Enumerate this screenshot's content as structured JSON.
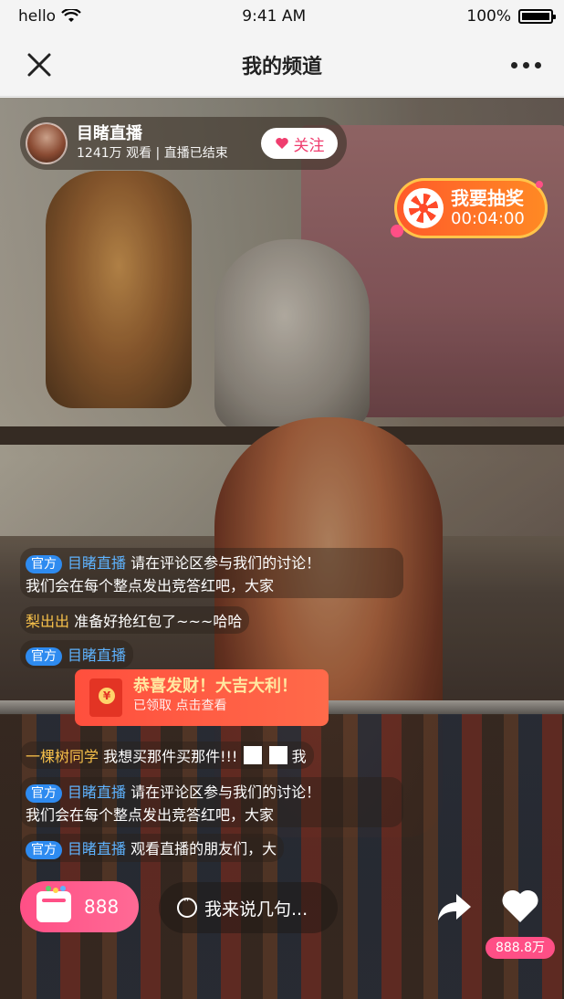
{
  "status_bar": {
    "carrier": "hello",
    "time": "9:41 AM",
    "battery": "100%"
  },
  "nav": {
    "title": "我的频道"
  },
  "anchor": {
    "name": "目睹直播",
    "meta": "1241万 观看 | 直播已结束",
    "follow_label": "关注"
  },
  "lottery": {
    "title": "我要抽奖",
    "countdown": "00:04:00"
  },
  "chat": [
    {
      "tag": "官方",
      "user": "目睹直播",
      "text": "请在评论区参与我们的讨论！",
      "line2": "我们会在每个整点发出竞答红吧，大家"
    },
    {
      "user": "梨出出",
      "text": "准备好抢红包了~~~哈哈"
    },
    {
      "tag": "官方",
      "user": "目睹直播"
    },
    {
      "user": "一棵树同学",
      "text": "我想买那件买那件!!!",
      "suffix": "我"
    },
    {
      "tag": "官方",
      "user": "目睹直播",
      "text": "请在评论区参与我们的讨论！",
      "line2": "我们会在每个整点发出竞答红吧，大家"
    },
    {
      "tag": "官方",
      "user": "目睹直播",
      "text": "观看直播的朋友们，大"
    }
  ],
  "red_packet": {
    "title": "恭喜发财！大吉大利！",
    "subtitle": "已领取 点击查看"
  },
  "bottom": {
    "gift_count": "888",
    "comment_placeholder": "我来说几句...",
    "like_count": "888.8万"
  },
  "colors": {
    "accent_pink": "#ff4f86",
    "official_tag": "#2e8bf0",
    "lottery_orange": "#ff6a2a"
  }
}
